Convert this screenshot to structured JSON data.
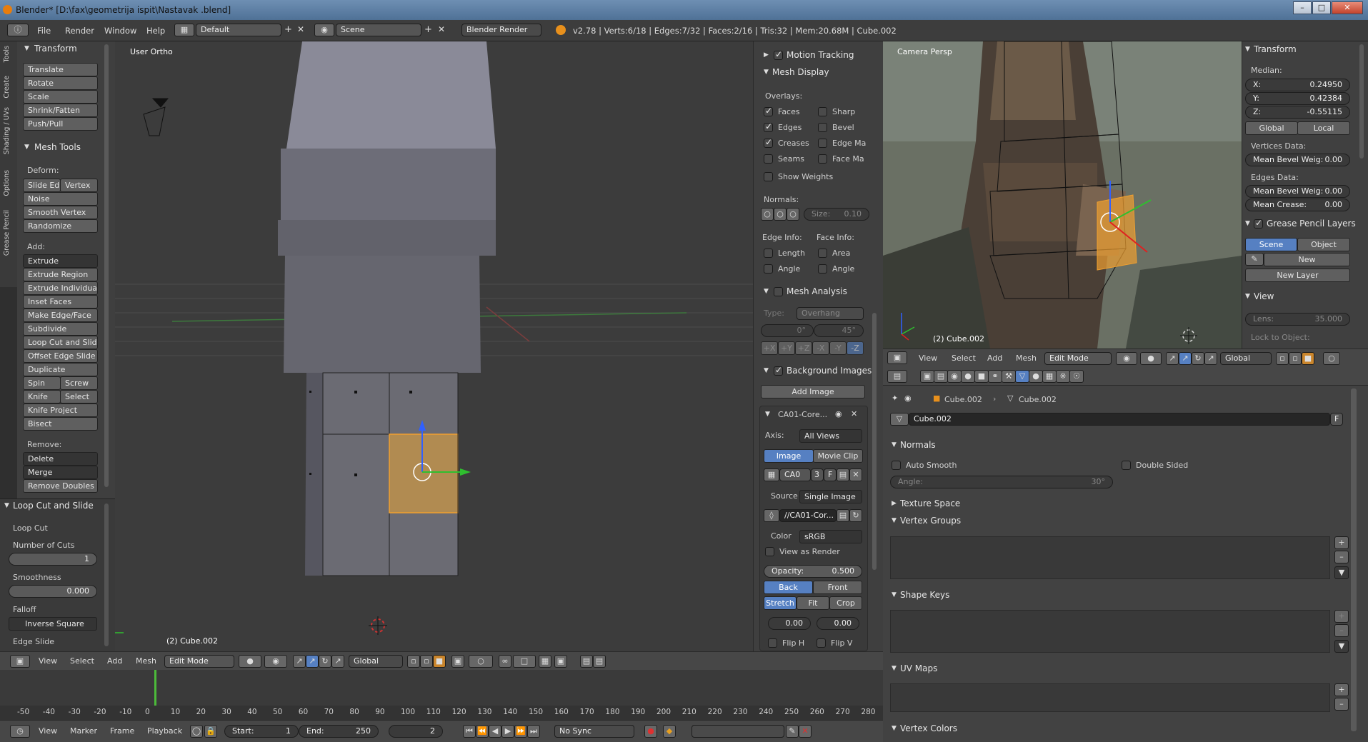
{
  "window": {
    "title": "Blender* [D:\\fax\\geometrija ispit\\Nastavak .blend]"
  },
  "menu": {
    "items": [
      "File",
      "Render",
      "Window",
      "Help"
    ],
    "layout": "Default",
    "scene": "Scene",
    "engine": "Blender Render",
    "stats": "v2.78 | Verts:6/18 | Edges:7/32 | Faces:2/16 | Tris:32 | Mem:20.68M | Cube.002"
  },
  "side_tabs": [
    "Tools",
    "Create",
    "Shading / UVs",
    "Options",
    "Grease Pencil"
  ],
  "tools": {
    "transform_header": "Transform",
    "transform": [
      "Translate",
      "Rotate",
      "Scale",
      "Shrink/Fatten",
      "Push/Pull"
    ],
    "mesh_tools_header": "Mesh Tools",
    "deform_label": "Deform:",
    "slide_edge": "Slide Ed",
    "vertex": "Vertex",
    "deform": [
      "Noise",
      "Smooth Vertex",
      "Randomize"
    ],
    "add_label": "Add:",
    "extrude": "Extrude",
    "add": [
      "Extrude Region",
      "Extrude Individual",
      "Inset Faces",
      "Make Edge/Face",
      "Subdivide",
      "Loop Cut and Slide",
      "Offset Edge Slide",
      "Duplicate"
    ],
    "spin": "Spin",
    "screw": "Screw",
    "knife": "Knife",
    "select": "Select",
    "add2": [
      "Knife Project",
      "Bisect"
    ],
    "remove_label": "Remove:",
    "delete": "Delete",
    "merge": "Merge",
    "remove_doubles": "Remove Doubles"
  },
  "operator": {
    "header": "Loop Cut and Slide",
    "loop_cut": "Loop Cut",
    "num_cuts_label": "Number of Cuts",
    "num_cuts": "1",
    "smooth_label": "Smoothness",
    "smooth": "0.000",
    "falloff_label": "Falloff",
    "falloff": "Inverse Square",
    "edge_slide": "Edge Slide"
  },
  "viewport": {
    "label": "User Ortho",
    "object": "(2) Cube.002"
  },
  "props": {
    "motion_tracking": "Motion Tracking",
    "mesh_display": "Mesh Display",
    "overlays": "Overlays:",
    "ov_left": [
      "Faces",
      "Edges",
      "Creases",
      "Seams"
    ],
    "ov_right": [
      "Sharp",
      "Bevel",
      "Edge Ma",
      "Face Ma"
    ],
    "show_weights": "Show Weights",
    "normals": "Normals:",
    "size": "Size:",
    "size_val": "0.10",
    "edge_info": "Edge Info:",
    "face_info": "Face Info:",
    "length": "Length",
    "area": "Area",
    "angle": "Angle",
    "angle2": "Angle",
    "mesh_analysis": "Mesh Analysis",
    "type": "Type:",
    "overhang": "Overhang",
    "min": "0°",
    "max": "45°",
    "axes": [
      "+X",
      "+Y",
      "+Z",
      "-X",
      "-Y",
      "-Z"
    ],
    "bg_images": "Background Images",
    "add_image": "Add Image",
    "image_name": "CA01-Core...",
    "axis_label": "Axis:",
    "axis": "All Views",
    "image": "Image",
    "movie_clip": "Movie Clip",
    "ca0": "CA0",
    "ca0_num": "3",
    "f": "F",
    "source_label": "Source",
    "source": "Single Image",
    "path": "//CA01-Cor...",
    "color_label": "Color",
    "color": "sRGB",
    "view_as_render": "View as Render",
    "opacity_label": "Opacity:",
    "opacity": "0.500",
    "back": "Back",
    "front": "Front",
    "stretch": "Stretch",
    "fit": "Fit",
    "crop": "Crop",
    "off_x": "0.00",
    "off_y": "0.00",
    "flip_h": "Flip H",
    "flip_v": "Flip V"
  },
  "camera": {
    "label": "Camera Persp",
    "object": "(2) Cube.002"
  },
  "right_n": {
    "transform": "Transform",
    "median": "Median:",
    "x": "0.24950",
    "y": "0.42384",
    "z": "-0.55115",
    "global": "Global",
    "local": "Local",
    "vertices_data": "Vertices Data:",
    "mbw": "Mean Bevel Weig:",
    "mbw_val": "0.00",
    "edges_data": "Edges Data:",
    "mbw2_val": "0.00",
    "mean_crease": "Mean Crease:",
    "mean_crease_val": "0.00",
    "gp_layers": "Grease Pencil Layers",
    "scene": "Scene",
    "object": "Object",
    "new": "New",
    "new_layer": "New Layer",
    "view": "View",
    "lens": "Lens:",
    "lens_val": "35.000",
    "lock": "Lock to Object:"
  },
  "cam_header": {
    "items": [
      "View",
      "Select",
      "Add",
      "Mesh"
    ],
    "mode": "Edit Mode",
    "orient": "Global"
  },
  "prop_editor": {
    "obj1": "Cube.002",
    "obj2": "Cube.002",
    "name": "Cube.002",
    "f": "F",
    "normals": "Normals",
    "auto_smooth": "Auto Smooth",
    "double_sided": "Double Sided",
    "angle": "Angle:",
    "angle_val": "30°",
    "texture_space": "Texture Space",
    "vertex_groups": "Vertex Groups",
    "shape_keys": "Shape Keys",
    "uv_maps": "UV Maps",
    "vertex_colors": "Vertex Colors"
  },
  "vp_header": {
    "items": [
      "View",
      "Select",
      "Add",
      "Mesh"
    ],
    "mode": "Edit Mode",
    "orient": "Global"
  },
  "timeline": {
    "ticks": [
      "-50",
      "-40",
      "-30",
      "-20",
      "-10",
      "0",
      "10",
      "20",
      "30",
      "40",
      "50",
      "60",
      "70",
      "80",
      "90",
      "100",
      "110",
      "120",
      "130",
      "140",
      "150",
      "160",
      "170",
      "180",
      "190",
      "200",
      "210",
      "220",
      "230",
      "240",
      "250",
      "260",
      "270",
      "280"
    ],
    "items": [
      "View",
      "Marker",
      "Frame",
      "Playback"
    ],
    "start_label": "Start:",
    "start": "1",
    "end_label": "End:",
    "end": "250",
    "current": "2",
    "sync": "No Sync"
  }
}
